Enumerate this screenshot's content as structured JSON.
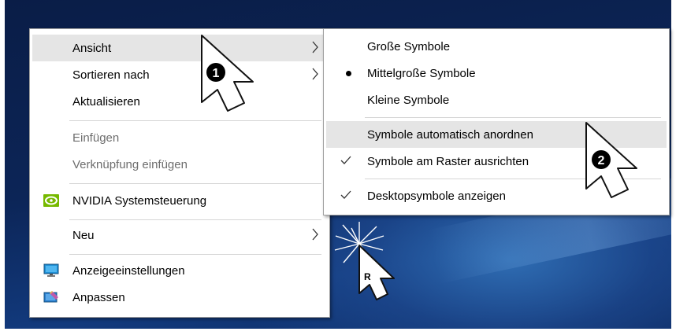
{
  "context_menu": {
    "items": [
      {
        "label": "Ansicht"
      },
      {
        "label": "Sortieren nach"
      },
      {
        "label": "Aktualisieren"
      },
      {
        "label": "Einfügen"
      },
      {
        "label": "Verknüpfung einfügen"
      },
      {
        "label": "NVIDIA Systemsteuerung"
      },
      {
        "label": "Neu"
      },
      {
        "label": "Anzeigeeinstellungen"
      },
      {
        "label": "Anpassen"
      }
    ]
  },
  "view_submenu": {
    "items": [
      {
        "label": "Große Symbole"
      },
      {
        "label": "Mittelgroße Symbole"
      },
      {
        "label": "Kleine Symbole"
      },
      {
        "label": "Symbole automatisch anordnen"
      },
      {
        "label": "Symbole am Raster ausrichten"
      },
      {
        "label": "Desktopsymbole anzeigen"
      }
    ]
  },
  "annotations": {
    "step1": "❶",
    "step2": "❷",
    "right_click": "R"
  },
  "colors": {
    "menu_background": "#ffffff",
    "highlight": "#e5e5e5",
    "disabled_text": "#6d6d6d",
    "nvidia_green": "#76b900",
    "desktop_blue": "#0c2557"
  }
}
